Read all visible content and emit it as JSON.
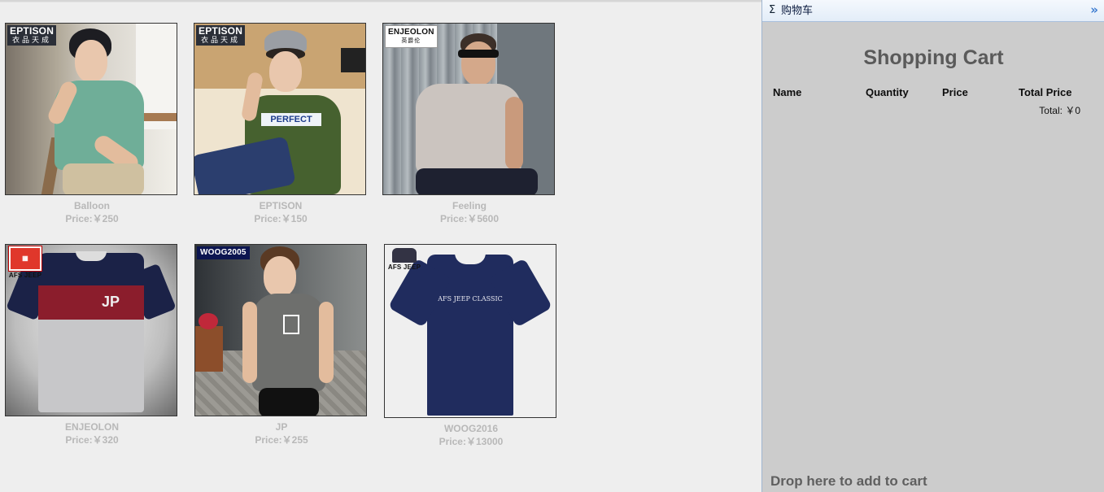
{
  "products": [
    {
      "name": "Balloon",
      "price": "Price:￥250",
      "logo": "EPTISON",
      "logo_sub": "衣品天成"
    },
    {
      "name": "EPTISON",
      "price": "Price:￥150",
      "logo": "EPTISON",
      "logo_sub": "衣品天成",
      "shirt_print": "PERFECT"
    },
    {
      "name": "Feeling",
      "price": "Price:￥5600",
      "logo": "ENJEOLON",
      "logo_sub": "英爵伦"
    },
    {
      "name": "ENJEOLON",
      "price": "Price:￥320",
      "logo": "AFS JEEP",
      "shirt_print": "JP"
    },
    {
      "name": "JP",
      "price": "Price:￥255",
      "logo": "WOOG2005"
    },
    {
      "name": "WOOG2016",
      "price": "Price:￥13000",
      "logo": "AFS JEEP",
      "shirt_print": "AFS JEEP CLASSIC"
    }
  ],
  "cart": {
    "header_title": "购物车",
    "sigma_glyph": "Σ",
    "collapse_glyph": "»",
    "title": "Shopping Cart",
    "columns": [
      "Name",
      "Quantity",
      "Price",
      "Total Price"
    ],
    "total_label": "Total: ￥0",
    "drop_hint": "Drop here to add to cart"
  },
  "icons": {
    "header": "sigma-icon",
    "collapse": "double-chevron-right-icon"
  },
  "colors": {
    "page_bg": "#eeeeee",
    "cart_bg": "#cccccc",
    "header_bg": "#e3edf8",
    "caption": "#b8b8b8"
  }
}
